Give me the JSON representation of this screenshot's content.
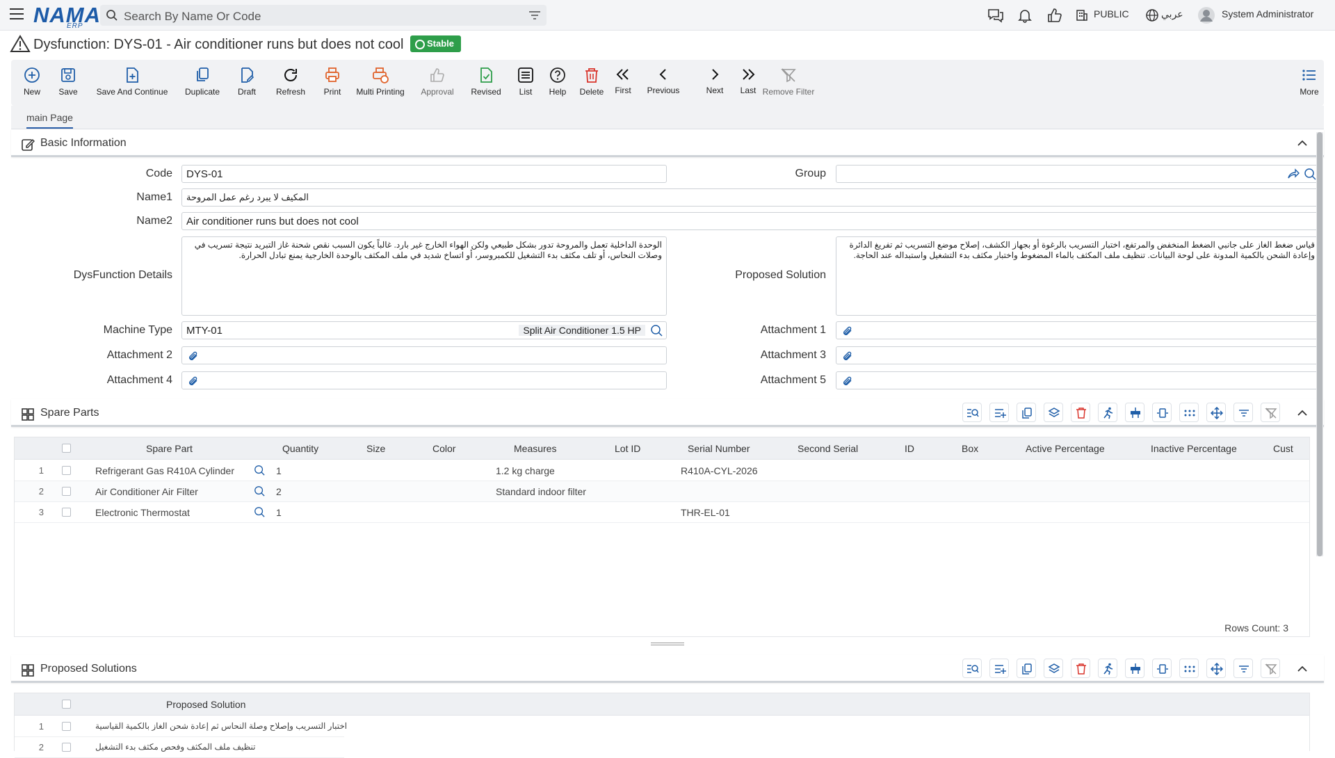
{
  "topbar": {
    "logo": "NAMA",
    "logo_sub": "ERP",
    "search_placeholder": "Search By Name Or Code",
    "public_label": "PUBLIC",
    "language_label": "عربي",
    "user_name": "System Administrator"
  },
  "page": {
    "title": "Dysfunction: DYS-01 - Air conditioner runs but does not cool",
    "status": "Stable"
  },
  "toolbar": {
    "new": "New",
    "save": "Save",
    "save_continue": "Save And Continue",
    "duplicate": "Duplicate",
    "draft": "Draft",
    "refresh": "Refresh",
    "print": "Print",
    "multi_printing": "Multi Printing",
    "approval": "Approval",
    "revised": "Revised",
    "list": "List",
    "help": "Help",
    "delete": "Delete",
    "first": "First",
    "previous": "Previous",
    "next": "Next",
    "last": "Last",
    "remove_filter": "Remove Filter",
    "more": "More"
  },
  "tabs": {
    "main": "main Page"
  },
  "basic_info": {
    "section_title": "Basic Information",
    "code_label": "Code",
    "code_value": "DYS-01",
    "group_label": "Group",
    "group_value": "",
    "name1_label": "Name1",
    "name1_value": "المكيف لا يبرد رغم عمل المروحة",
    "name2_label": "Name2",
    "name2_value": "Air conditioner runs but does not cool",
    "details_label": "DysFunction Details",
    "details_value": "الوحدة الداخلية تعمل والمروحة تدور بشكل طبيعي ولكن الهواء الخارج غير بارد. غالباً يكون السبب نقص شحنة غاز التبريد نتيجة تسريب في وصلات النحاس، أو تلف مكثف بدء التشغيل للكمبروسر، أو اتساخ شديد في ملف المكثف بالوحدة الخارجية يمنع تبادل الحرارة.",
    "solution_label": "Proposed Solution",
    "solution_value": "قياس ضغط الغاز على جانبي الضغط المنخفض والمرتفع، اختبار التسريب بالرغوة أو بجهاز الكشف، إصلاح موضع التسريب ثم تفريغ الدائرة وإعادة الشحن بالكمية المدونة على لوحة البيانات. تنظيف ملف المكثف بالماء المضغوط واختبار مكثف بدء التشغيل واستبداله عند الحاجة.",
    "machine_type_label": "Machine Type",
    "machine_type_value": "MTY-01",
    "machine_type_desc": "Split Air Conditioner 1.5 HP",
    "attachment1_label": "Attachment 1",
    "attachment2_label": "Attachment 2",
    "attachment3_label": "Attachment 3",
    "attachment4_label": "Attachment 4",
    "attachment5_label": "Attachment 5"
  },
  "spare_parts": {
    "section_title": "Spare Parts",
    "columns": [
      "Spare Part",
      "Quantity",
      "Size",
      "Color",
      "Measures",
      "Lot ID",
      "Serial Number",
      "Second Serial",
      "ID",
      "Box",
      "Active Percentage",
      "Inactive Percentage",
      "Cust"
    ],
    "rows": [
      {
        "n": "1",
        "part": "Refrigerant Gas R410A Cylinder",
        "qty": "1",
        "measures": "1.2 kg charge",
        "serial": "R410A-CYL-2026"
      },
      {
        "n": "2",
        "part": "Air Conditioner Air Filter",
        "qty": "2",
        "measures": "Standard indoor filter",
        "serial": ""
      },
      {
        "n": "3",
        "part": "Electronic Thermostat",
        "qty": "1",
        "measures": "",
        "serial": "THR-EL-01"
      }
    ],
    "rows_count": "Rows Count: 3"
  },
  "proposed_solutions": {
    "section_title": "Proposed Solutions",
    "column": "Proposed Solution",
    "rows": [
      {
        "n": "1",
        "text": "اختبار التسريب وإصلاح وصلة النحاس ثم إعادة شحن الغاز بالكمية القياسية"
      },
      {
        "n": "2",
        "text": "تنظيف ملف المكثف وفحص مكثف بدء التشغيل"
      }
    ]
  },
  "colors": {
    "brand": "#1d5ba8",
    "stable": "#2e9e4a",
    "delete": "#d9342b",
    "print": "#e0622a",
    "icon": "#1f5ea8"
  }
}
